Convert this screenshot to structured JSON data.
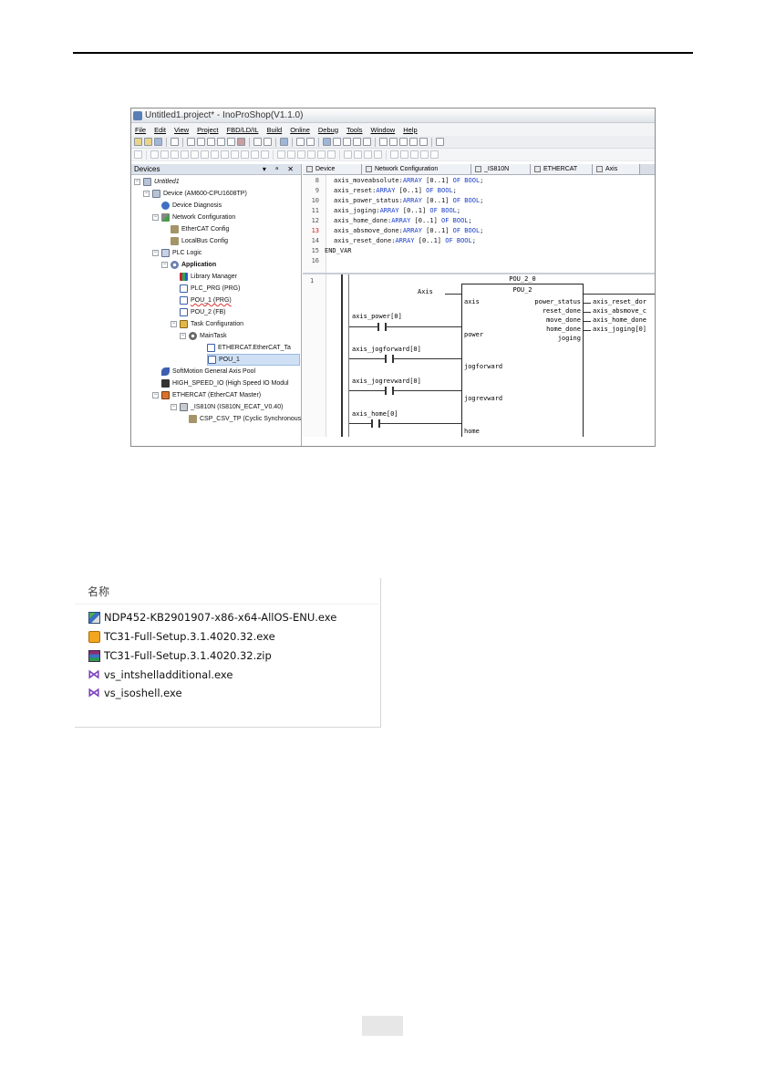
{
  "ide": {
    "title": "Untitled1.project* - InoProShop(V1.1.0)",
    "menu": [
      "File",
      "Edit",
      "View",
      "Project",
      "FBD/LD/IL",
      "Build",
      "Online",
      "Debug",
      "Tools",
      "Window",
      "Help"
    ],
    "devices_panel": {
      "title": "Devices",
      "controls": "▾ ᵃ ✕",
      "items": [
        {
          "label": "Untitled1",
          "icon": "project-icon"
        },
        {
          "label": "Device (AM600-CPU1608TP)",
          "icon": "device-icon"
        },
        {
          "label": "Device Diagnosis",
          "icon": "diagnosis-icon"
        },
        {
          "label": "Network Configuration",
          "icon": "network-icon"
        },
        {
          "label": "EtherCAT Config",
          "icon": "plug-icon"
        },
        {
          "label": "LocalBus Config",
          "icon": "plug-icon"
        },
        {
          "label": "PLC Logic",
          "icon": "plc-icon"
        },
        {
          "label": "Application",
          "icon": "application-icon"
        },
        {
          "label": "Library Manager",
          "icon": "library-icon"
        },
        {
          "label": "PLC_PRG (PRG)",
          "icon": "pou-icon"
        },
        {
          "label": "POU_1 (PRG)",
          "icon": "pou-icon"
        },
        {
          "label": "POU_2 (FB)",
          "icon": "pou-icon"
        },
        {
          "label": "Task Configuration",
          "icon": "task-icon"
        },
        {
          "label": "MainTask",
          "icon": "gear-icon"
        },
        {
          "label": "ETHERCAT.EtherCAT_Ta",
          "icon": "pou-icon"
        },
        {
          "label": "POU_1",
          "icon": "pou-icon"
        },
        {
          "label": "SoftMotion General Axis Pool",
          "icon": "softmotion-icon"
        },
        {
          "label": "HIGH_SPEED_IO (High Speed IO Modul",
          "icon": "io-icon"
        },
        {
          "label": "ETHERCAT (EtherCAT Master)",
          "icon": "ethercat-icon"
        },
        {
          "label": "_IS810N (IS810N_ECAT_V0.40)",
          "icon": "slave-icon"
        },
        {
          "label": "CSP_CSV_TP (Cyclic Synchronous",
          "icon": "plug-icon"
        }
      ]
    },
    "tabs": [
      "Device",
      "Network Configuration",
      "_IS810N",
      "ETHERCAT",
      "Axis"
    ],
    "code_lines": [
      {
        "n": "8",
        "name": "axis_moveabsolute:",
        "kw1": "ARRAY",
        "mid": " [0..1] ",
        "kw2": "OF BOOL",
        "end": ";"
      },
      {
        "n": "9",
        "name": "axis_reset:",
        "kw1": "ARRAY",
        "mid": " [0..1] ",
        "kw2": "OF BOOL",
        "end": ";"
      },
      {
        "n": "10",
        "name": "axis_power_status:",
        "kw1": "ARRAY",
        "mid": " [0..1] ",
        "kw2": "OF BOOL",
        "end": ";"
      },
      {
        "n": "11",
        "name": "axis_joging:",
        "kw1": "ARRAY",
        "mid": " [0..1] ",
        "kw2": "OF BOOL",
        "end": ";"
      },
      {
        "n": "12",
        "name": "axis_home_done:",
        "kw1": "ARRAY",
        "mid": " [0..1] ",
        "kw2": "OF BOOL",
        "end": ";"
      },
      {
        "n": "13",
        "name": "axis_absmove_done:",
        "kw1": "ARRAY",
        "mid": " [0..1] ",
        "kw2": "OF BOOL",
        "end": ";"
      },
      {
        "n": "14",
        "name": "axis_reset_done:",
        "kw1": "ARRAY",
        "mid": " [0..1] ",
        "kw2": "OF BOOL",
        "end": ";"
      }
    ],
    "end_var": {
      "n": "15",
      "text": "END_VAR"
    },
    "blank_line": "16",
    "ladder": {
      "rung": "1",
      "instance": "POU_2_0",
      "type": "POU_2",
      "axis_label": "Axis",
      "inputs": [
        "axis",
        "power",
        "jogforward",
        "jogrevward",
        "home"
      ],
      "outputs": [
        "power_status",
        "reset_done",
        "move_done",
        "home_done",
        "joging"
      ],
      "contacts": [
        "axis_power[0]",
        "axis_jogforward[0]",
        "axis_jogrevward[0]",
        "axis_home[0]"
      ],
      "out_vars": [
        "axis_reset_dor",
        "axis_absmove_c",
        "axis_home_done",
        "axis_joging[0]"
      ]
    }
  },
  "files": {
    "header": "名称",
    "items": [
      {
        "name": "NDP452-KB2901907-x86-x64-AllOS-ENU.exe",
        "icon": "setup-icon"
      },
      {
        "name": "TC31-Full-Setup.3.1.4020.32.exe",
        "icon": "twincat-icon"
      },
      {
        "name": "TC31-Full-Setup.3.1.4020.32.zip",
        "icon": "archive-icon"
      },
      {
        "name": "vs_intshelladditional.exe",
        "icon": "visual-studio-icon"
      },
      {
        "name": "vs_isoshell.exe",
        "icon": "visual-studio-icon"
      }
    ]
  }
}
